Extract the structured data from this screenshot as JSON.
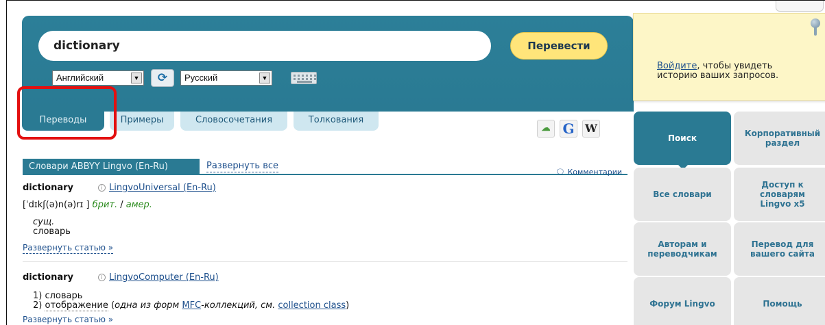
{
  "search": {
    "query": "dictionary",
    "translate_label": "Перевести",
    "source_language": "Английский",
    "target_language": "Русский"
  },
  "tabs": [
    {
      "label": "Переводы",
      "active": true
    },
    {
      "label": "Примеры",
      "active": false
    },
    {
      "label": "Словосочетания",
      "active": false
    },
    {
      "label": "Толкования",
      "active": false
    }
  ],
  "tools": [
    {
      "icon": "speech-bubble-icon"
    },
    {
      "icon": "google-icon",
      "label": "G"
    },
    {
      "icon": "wikipedia-icon",
      "label": "W"
    }
  ],
  "dictionary": {
    "header": "Словари ABBYY Lingvo (En-Ru)",
    "expand_all": "Развернуть все",
    "comments": "Комментарии"
  },
  "entries": [
    {
      "word": "dictionary",
      "source": "LingvoUniversal (En-Ru)",
      "transcription": "[ˈdɪkʃ(ə)n(ə)rɪ ]",
      "region_br": "брит.",
      "slash": "/",
      "region_am": "амер.",
      "pos": "сущ.",
      "translation": "словарь",
      "expand": "Развернуть статью »"
    },
    {
      "word": "dictionary",
      "source": "LingvoComputer (En-Ru)",
      "line1": "1) словарь",
      "line2_prefix": "2) ",
      "line2_term": "отображение",
      "line2_note_a": " (",
      "line2_note_b": "одна из форм ",
      "line2_mfc": "MFC",
      "line2_note_c": "-коллекций, см. ",
      "line2_link": "collection class",
      "line2_close": ")",
      "expand": "Развернуть статью »"
    }
  ],
  "login_note": {
    "link": "Войдите",
    "text": ", чтобы увидеть историю ваших запросов."
  },
  "menu": [
    {
      "label": "Поиск",
      "active": true
    },
    {
      "label": "Корпоративный раздел",
      "active": false
    },
    {
      "label": "Все словари",
      "active": false
    },
    {
      "label": "Доступ к словарям Lingvo x5",
      "active": false
    },
    {
      "label": "Авторам и переводчикам",
      "active": false
    },
    {
      "label": "Перевод для вашего сайта",
      "active": false
    },
    {
      "label": "Форум Lingvo",
      "active": false
    },
    {
      "label": "Помощь",
      "active": false
    }
  ],
  "colors": {
    "panel": "#2a7a93",
    "button_yellow": "#ffe57a",
    "highlight_red": "#e31010",
    "note_yellow": "#fdf6c7"
  }
}
